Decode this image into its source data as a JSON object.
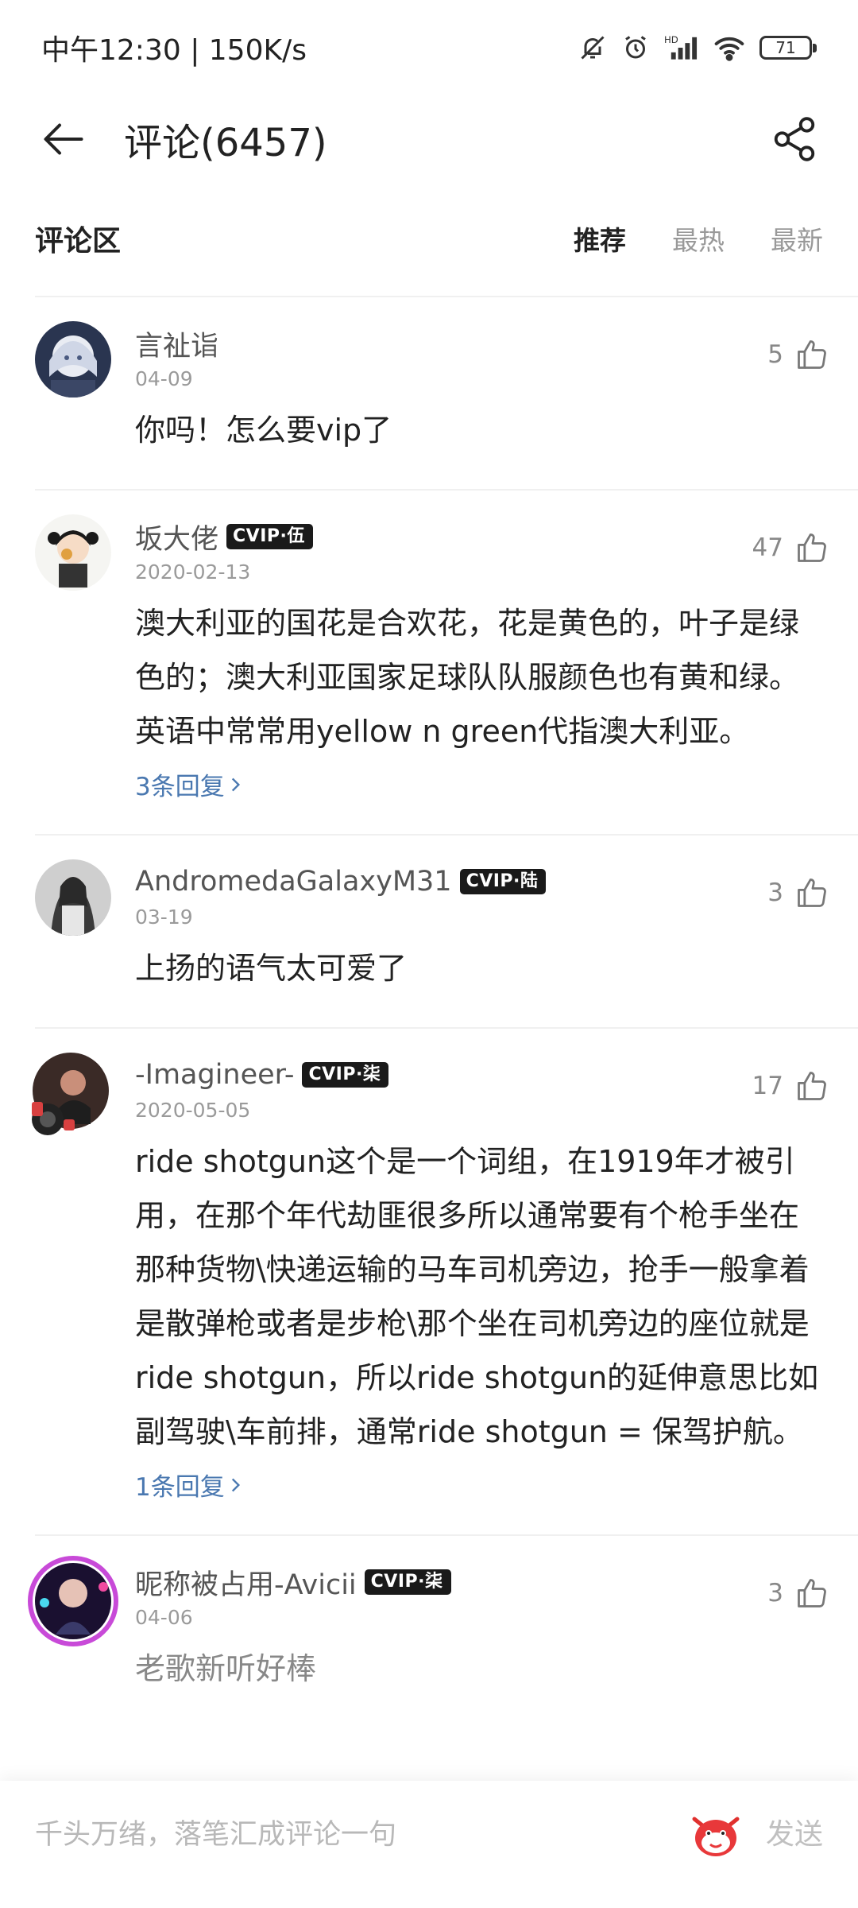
{
  "status_bar": {
    "time_speed": "中午12:30 | 150K/s",
    "battery": "71",
    "icons": [
      "bell-off-icon",
      "alarm-icon",
      "hd-signal-icon",
      "wifi-icon",
      "battery-icon"
    ]
  },
  "header": {
    "title": "评论(6457)",
    "back_icon": "arrow-left-icon",
    "share_icon": "share-icon"
  },
  "section": {
    "label": "评论区",
    "tabs": [
      {
        "label": "推荐",
        "active": true
      },
      {
        "label": "最热",
        "active": false
      },
      {
        "label": "最新",
        "active": false
      }
    ]
  },
  "comments": [
    {
      "username": "言祉诣",
      "vip": "",
      "date": "04-09",
      "likes": "5",
      "text": "你吗！怎么要vip了",
      "replies": ""
    },
    {
      "username": "坂大佬",
      "vip": "CVIP·伍",
      "date": "2020-02-13",
      "likes": "47",
      "text": "澳大利亚的国花是合欢花，花是黄色的，叶子是绿色的；澳大利亚国家足球队队服颜色也有黄和绿。英语中常常用yellow n green代指澳大利亚。",
      "replies": "3条回复"
    },
    {
      "username": "AndromedaGalaxyM31",
      "vip": "CVIP·陆",
      "date": "03-19",
      "likes": "3",
      "text": "上扬的语气太可爱了",
      "replies": ""
    },
    {
      "username": "-Imagineer-",
      "vip": "CVIP·柒",
      "date": "2020-05-05",
      "likes": "17",
      "text": "ride shotgun这个是一个词组，在1919年才被引用，在那个年代劫匪很多所以通常要有个枪手坐在那种货物\\快递运输的马车司机旁边，抢手一般拿着是散弹枪或者是步枪\\那个坐在司机旁边的座位就是ride shotgun，所以ride shotgun的延伸意思比如副驾驶\\车前排，通常ride shotgun = 保驾护航。",
      "replies": "1条回复"
    },
    {
      "username": "昵称被占用-Avicii",
      "vip": "CVIP·柒",
      "date": "04-06",
      "likes": "3",
      "text": "老歌新听好棒",
      "replies": ""
    }
  ],
  "input_bar": {
    "placeholder": "千头万绪，落笔汇成评论一句",
    "send_label": "发送",
    "emoji_icon": "emoji-face-icon"
  },
  "colors": {
    "reply_link": "#4a78b0",
    "vip_badge_bg": "#1a1a1a",
    "muted_text": "#999999"
  }
}
